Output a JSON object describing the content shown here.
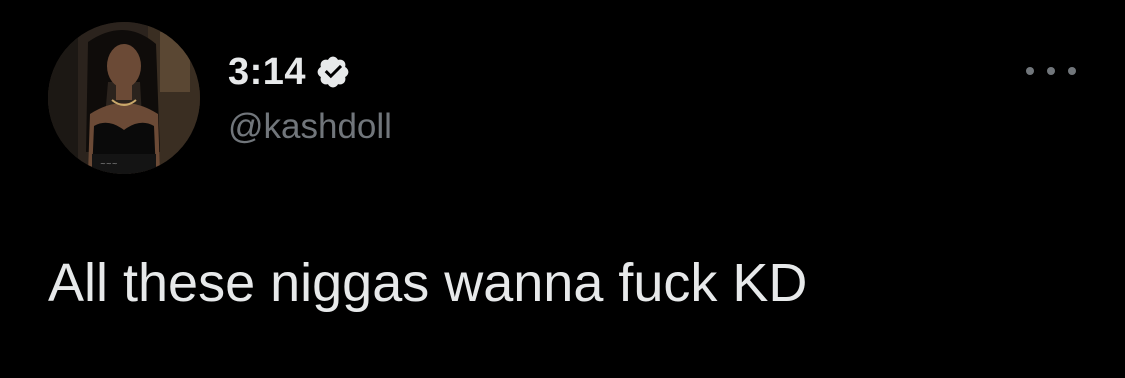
{
  "tweet": {
    "display_name": "3:14",
    "handle": "@kashdoll",
    "text": "All these niggas wanna fuck KD",
    "verified": true,
    "avatar": "profile-photo"
  },
  "icons": {
    "verified": "verified-badge-icon",
    "more": "more-options-icon"
  },
  "colors": {
    "background": "#000000",
    "primary_text": "#e7e9ea",
    "secondary_text": "#71767b"
  }
}
